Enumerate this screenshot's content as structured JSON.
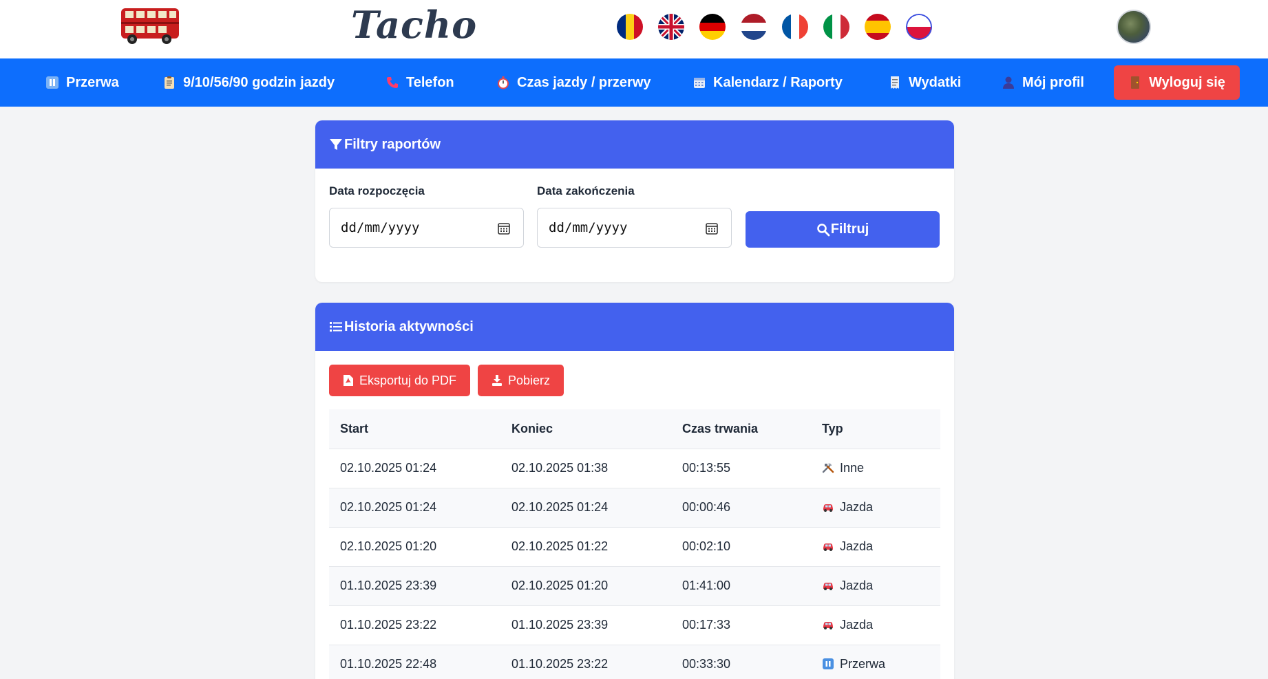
{
  "header": {
    "logo_text": "Tacho",
    "flags": [
      "ro",
      "gb",
      "de",
      "nl",
      "fr",
      "it",
      "es",
      "pl"
    ],
    "active_flag": "pl"
  },
  "nav": {
    "items": [
      {
        "label": "Przerwa",
        "icon": "pause-icon"
      },
      {
        "label": "9/10/56/90 godzin jazdy",
        "icon": "clipboard-icon"
      },
      {
        "label": "Telefon",
        "icon": "phone-icon"
      },
      {
        "label": "Czas jazdy / przerwy",
        "icon": "stopwatch-icon"
      },
      {
        "label": "Kalendarz / Raporty",
        "icon": "calendar-icon"
      },
      {
        "label": "Wydatki",
        "icon": "receipt-icon"
      },
      {
        "label": "Mój profil",
        "icon": "user-icon"
      }
    ],
    "logout_label": "Wyloguj się"
  },
  "filters": {
    "title": "Filtry raportów",
    "start_label": "Data rozpoczęcia",
    "end_label": "Data zakończenia",
    "start_value": "dd/mm/yyyy",
    "end_value": "dd/mm/yyyy",
    "filter_button": "Filtruj"
  },
  "history": {
    "title": "Historia aktywności",
    "export_pdf": "Eksportuj do PDF",
    "download": "Pobierz",
    "columns": [
      "Start",
      "Koniec",
      "Czas trwania",
      "Typ"
    ],
    "rows": [
      {
        "start": "02.10.2025 01:24",
        "end": "02.10.2025 01:38",
        "duration": "00:13:55",
        "type": "Inne",
        "icon": "tools-icon"
      },
      {
        "start": "02.10.2025 01:24",
        "end": "02.10.2025 01:24",
        "duration": "00:00:46",
        "type": "Jazda",
        "icon": "car-icon"
      },
      {
        "start": "02.10.2025 01:20",
        "end": "02.10.2025 01:22",
        "duration": "00:02:10",
        "type": "Jazda",
        "icon": "car-icon"
      },
      {
        "start": "01.10.2025 23:39",
        "end": "02.10.2025 01:20",
        "duration": "01:41:00",
        "type": "Jazda",
        "icon": "car-icon"
      },
      {
        "start": "01.10.2025 23:22",
        "end": "01.10.2025 23:39",
        "duration": "00:17:33",
        "type": "Jazda",
        "icon": "car-icon"
      },
      {
        "start": "01.10.2025 22:48",
        "end": "01.10.2025 23:22",
        "duration": "00:33:30",
        "type": "Przerwa",
        "icon": "pause-icon"
      }
    ]
  },
  "colors": {
    "nav_bg": "#0d6efd",
    "card_header": "#4361ee",
    "danger": "#ef4444",
    "page_bg": "#f3f4f6"
  }
}
